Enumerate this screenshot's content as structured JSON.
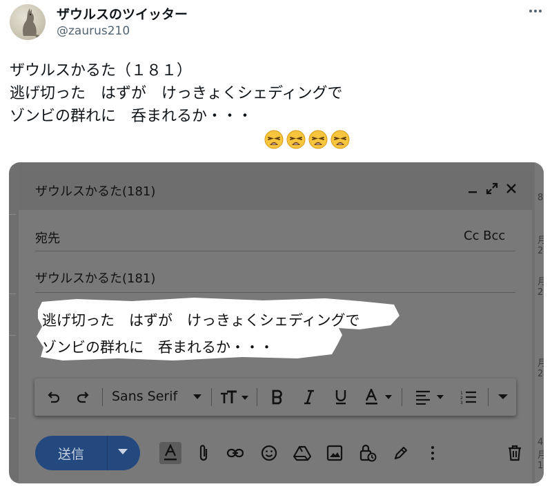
{
  "tweet": {
    "display_name": "ザウルスのツイッター",
    "handle": "@zaurus210",
    "lines": [
      "ザウルスかるた（１８１）",
      "逃げ切った　はずが　けっきょくシェディングで",
      "ゾンビの群れに　呑まれるか・・・"
    ],
    "emoji": [
      "weary-face",
      "weary-face",
      "weary-face",
      "weary-face"
    ]
  },
  "compose": {
    "title": "ザウルスかるた(181)",
    "to_label": "宛先",
    "cc_bcc_label": "Cc Bcc",
    "subject": "ザウルスかるた(181)",
    "body_lines": [
      "逃げ切った　はずが　けっきょくシェディングで",
      "ゾンビの群れに　呑まれるか・・・"
    ],
    "font_name": "Sans Serif",
    "send_label": "送信",
    "background_numbers": [
      "8",
      "月2",
      "月2",
      "月24",
      "4月1"
    ]
  },
  "colors": {
    "handle": "#536471",
    "send_button": "#23497f",
    "overlay_gray": "#797979"
  }
}
